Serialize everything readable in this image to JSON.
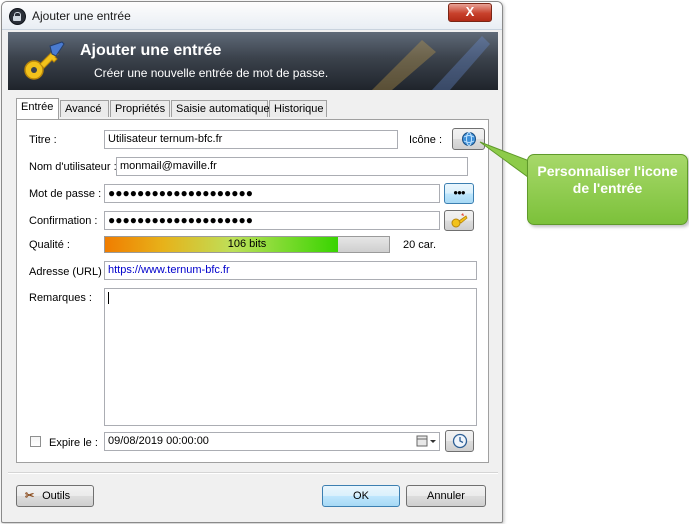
{
  "window": {
    "title": "Ajouter une entrée",
    "close_glyph": "X"
  },
  "banner": {
    "title": "Ajouter une entrée",
    "subtitle": "Créer une nouvelle entrée de mot de passe."
  },
  "tabs": [
    "Entrée",
    "Avancé",
    "Propriétés",
    "Saisie automatique",
    "Historique"
  ],
  "form": {
    "title_label": "Titre :",
    "title_value": "Utilisateur ternum-bfc.fr",
    "icon_label": "Icône :",
    "username_label": "Nom d'utilisateur :",
    "username_value": "monmail@maville.fr",
    "password_label": "Mot de passe :",
    "password_value": "●●●●●●●●●●●●●●●●●●●●",
    "show_password_glyph": "●●●",
    "confirm_label": "Confirmation :",
    "confirm_value": "●●●●●●●●●●●●●●●●●●●●",
    "quality_label": "Qualité :",
    "quality_text": "106 bits",
    "quality_fraction": 0.82,
    "quality_chars": "20 car.",
    "url_label": "Adresse (URL) :",
    "url_value": "https://www.ternum-bfc.fr",
    "notes_label": "Remarques :",
    "notes_value": "",
    "expire_label": "Expire le :",
    "expire_checked": false,
    "expire_value": "09/08/2019 00:00:00"
  },
  "footer": {
    "tools_label": "Outils",
    "ok_label": "OK",
    "cancel_label": "Annuler"
  },
  "callout": {
    "text": "Personnaliser l'icone de l'entrée"
  },
  "colors": {
    "callout_green": "#8dcb4a",
    "banner_dark": "#2b3038",
    "url_blue": "#0000cc"
  }
}
